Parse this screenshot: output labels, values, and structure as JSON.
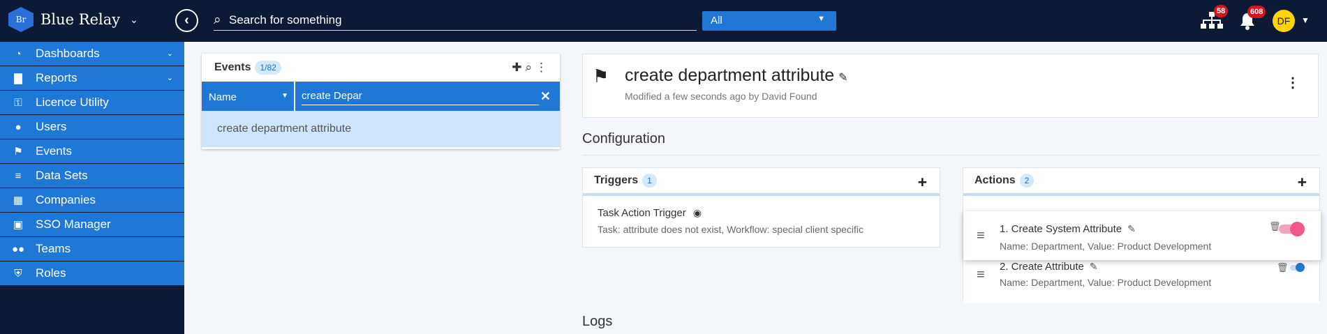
{
  "brand": {
    "logo_text": "Br",
    "name": "Blue Relay"
  },
  "search": {
    "placeholder": "Search for something",
    "scope": "All"
  },
  "topbar": {
    "org_badge": "58",
    "notifications_badge": "608",
    "avatar_initials": "DF"
  },
  "sidebar": {
    "items": [
      {
        "label": "Dashboards",
        "icon": "gauge-icon"
      },
      {
        "label": "Reports",
        "icon": "bar-chart-icon"
      },
      {
        "label": "Licence Utility",
        "icon": "key-icon"
      },
      {
        "label": "Users",
        "icon": "user-icon"
      },
      {
        "label": "Events",
        "icon": "flag-icon"
      },
      {
        "label": "Data Sets",
        "icon": "database-icon"
      },
      {
        "label": "Companies",
        "icon": "building-icon"
      },
      {
        "label": "SSO Manager",
        "icon": "id-badge-icon"
      },
      {
        "label": "Teams",
        "icon": "users-icon"
      },
      {
        "label": "Roles",
        "icon": "shield-icon"
      }
    ]
  },
  "events_panel": {
    "title": "Events",
    "count": "1/82",
    "filter_field": "Name",
    "filter_value": "create Depar",
    "result": "create department attribute"
  },
  "detail": {
    "title": "create department attribute",
    "modified": "Modified a few seconds ago by David Found"
  },
  "configuration": {
    "title": "Configuration"
  },
  "triggers": {
    "title": "Triggers",
    "count": "1",
    "items": [
      {
        "name": "Task Action Trigger",
        "description": "Task: attribute does not exist, Workflow: special client specific"
      }
    ]
  },
  "actions": {
    "title": "Actions",
    "count": "2",
    "items": [
      {
        "name": "1. Create System Attribute",
        "description": "Name: Department, Value: Product Development",
        "enabled": true
      },
      {
        "name": "2. Create Attribute",
        "description": "Name: Department, Value: Product Development",
        "enabled": true
      }
    ]
  },
  "logs": {
    "title": "Logs"
  },
  "colors": {
    "topbar": "#0c1a36",
    "accent": "#1f78d6",
    "badge": "#d2161e",
    "avatar": "#ffd500",
    "toggle_active": "#f0578b"
  }
}
